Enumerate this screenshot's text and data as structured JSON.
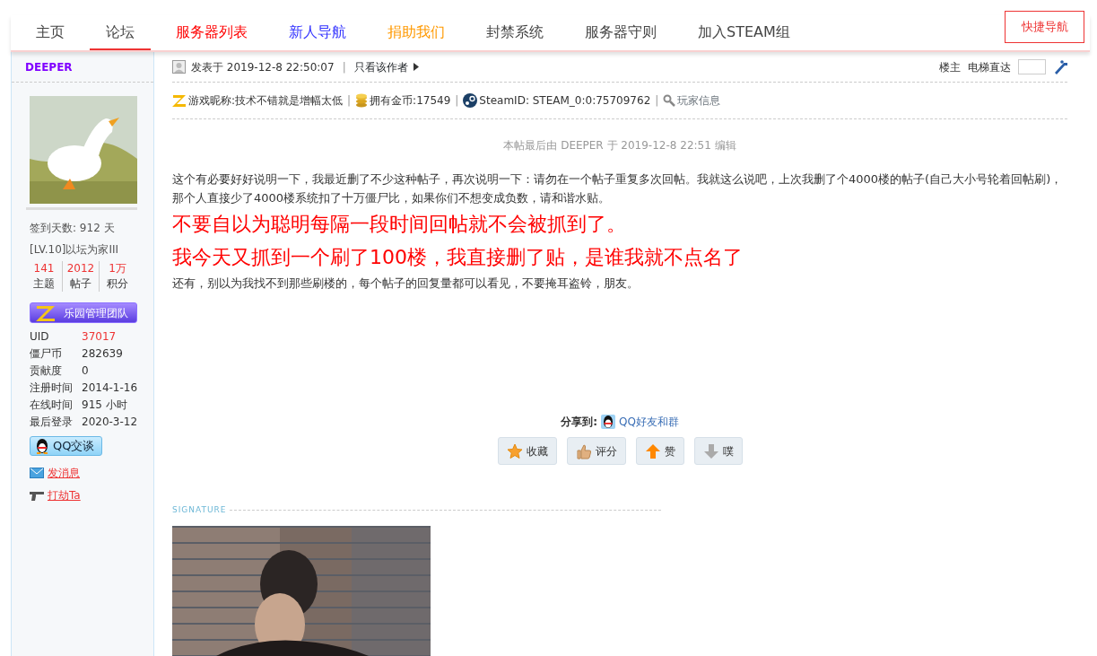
{
  "nav": {
    "items": [
      {
        "label": "主页",
        "selected": false
      },
      {
        "label": "论坛",
        "selected": true
      },
      {
        "label": "服务器列表",
        "selected": false,
        "color": "#ff0000"
      },
      {
        "label": "新人导航",
        "selected": false,
        "color": "#3333ff"
      },
      {
        "label": "捐助我们",
        "selected": false,
        "color": "#ff9900"
      },
      {
        "label": "封禁系统",
        "selected": false
      },
      {
        "label": "服务器守则",
        "selected": false
      },
      {
        "label": "加入STEAM组",
        "selected": false
      }
    ],
    "quick_nav": "快捷导航"
  },
  "author": {
    "name": "DEEPER",
    "checkin": "签到天数: 912 天",
    "level": "[LV.10]以坛为家III",
    "stats": [
      {
        "value": "141",
        "label": "主题"
      },
      {
        "value": "2012",
        "label": "帖子"
      },
      {
        "value": "1万",
        "label": "积分"
      }
    ],
    "group": "乐园管理团队",
    "fields": [
      {
        "label": "UID",
        "value": "37017",
        "kind": "link"
      },
      {
        "label": "僵尸币",
        "value": "282639",
        "kind": "plain"
      },
      {
        "label": "贡献度",
        "value": "0",
        "kind": "plain"
      },
      {
        "label": "注册时间",
        "value": "2014-1-16",
        "kind": "plain"
      },
      {
        "label": "在线时间",
        "value": "915 小时",
        "kind": "plain"
      },
      {
        "label": "最后登录",
        "value": "2020-3-12",
        "kind": "plain"
      }
    ],
    "qq_chat": "QQ交谈",
    "actions": [
      {
        "label": "发消息",
        "kind": "mail"
      },
      {
        "label": "打劫Ta",
        "kind": "gun"
      }
    ]
  },
  "post": {
    "posted": "发表于 2019-12-8 22:50:07",
    "separator": "|",
    "author_only": "只看该作者",
    "floor": "楼主",
    "jump_label": "电梯直达",
    "info": [
      {
        "kind": "nick",
        "text": "游戏昵称:技术不错就是增幅太低"
      },
      {
        "kind": "coin",
        "text": "拥有金币:17549"
      },
      {
        "kind": "steam",
        "text": "SteamID: STEAM_0:0:75709762"
      },
      {
        "kind": "player",
        "text": "玩家信息"
      }
    ],
    "edit_note": "本帖最后由 DEEPER 于 2019-12-8 22:51 编辑",
    "paragraphs": [
      {
        "kind": "normal",
        "text": "这个有必要好好说明一下，我最近删了不少这种帖子，再次说明一下：请勿在一个帖子重复多次回帖。我就这么说吧，上次我删了个4000楼的帖子(自己大小号轮着回帖刷)，那个人直接少了4000楼系统扣了十万僵尸比，如果你们不想变成负数，请和谐水贴。"
      },
      {
        "kind": "alert",
        "text": "不要自以为聪明每隔一段时间回帖就不会被抓到了。"
      },
      {
        "kind": "alert",
        "text": "我今天又抓到一个刷了100楼，我直接删了贴，是谁我就不点名了"
      },
      {
        "kind": "normal",
        "text": "还有，别以为我找不到那些刷楼的，每个帖子的回复量都可以看见，不要掩耳盗铃，朋友。"
      }
    ],
    "share_label": "分享到:",
    "share_target": "QQ好友和群",
    "buttons": [
      {
        "label": "收藏",
        "kind": "star"
      },
      {
        "label": "评分",
        "kind": "thumb"
      },
      {
        "label": "赞",
        "kind": "up"
      },
      {
        "label": "噗",
        "kind": "down"
      }
    ],
    "signature_label": "SIGNATURE"
  }
}
